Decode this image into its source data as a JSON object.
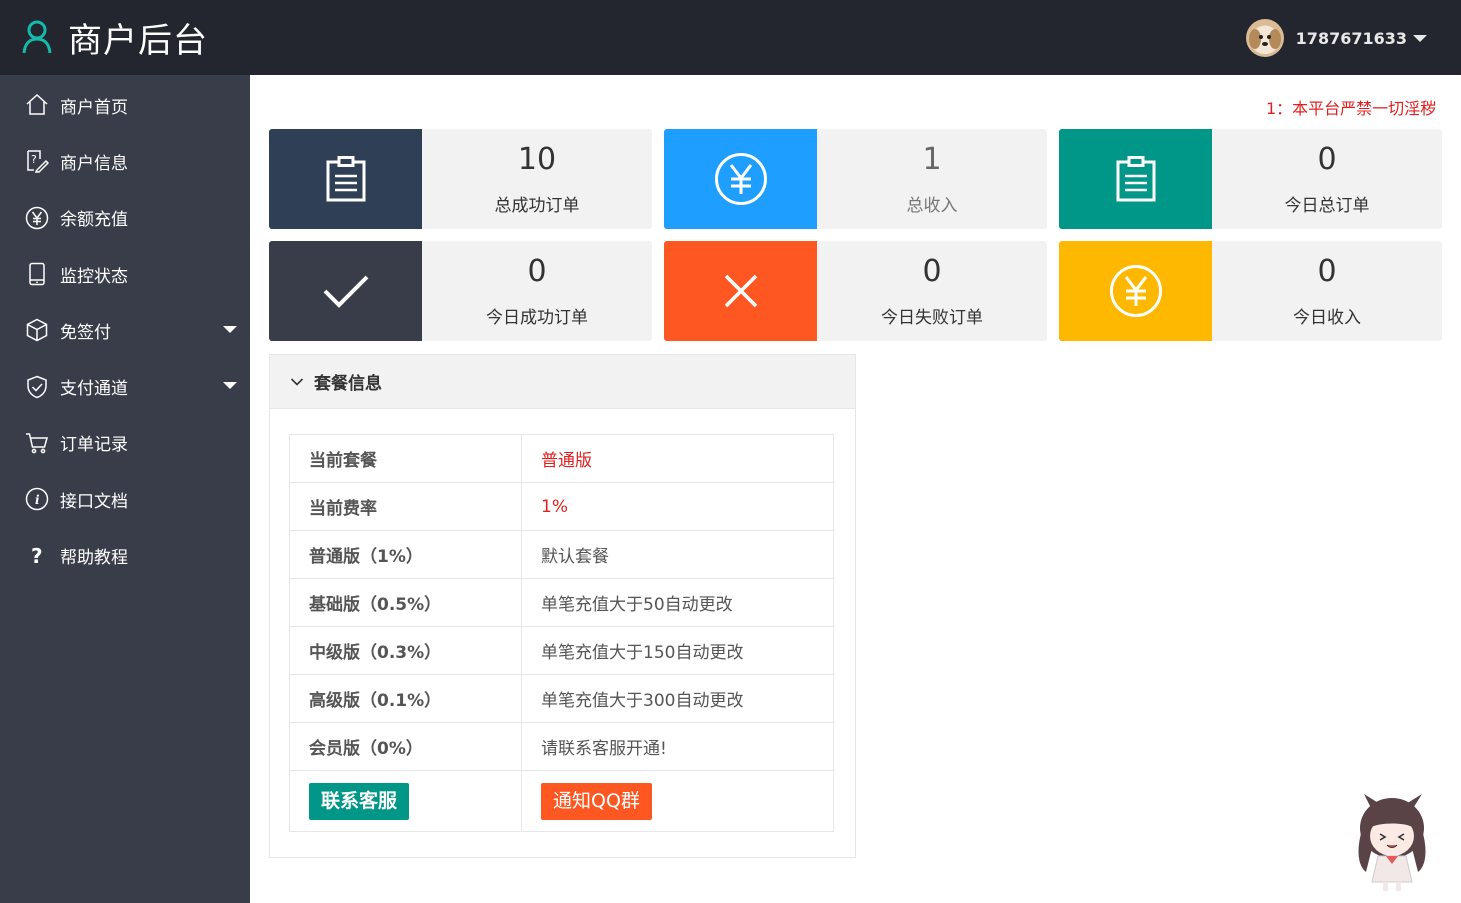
{
  "header": {
    "title": "商户后台",
    "user_name": "1787671633"
  },
  "sidebar": {
    "items": [
      {
        "label": "商户首页",
        "icon": "home-icon",
        "has_submenu": false
      },
      {
        "label": "商户信息",
        "icon": "edit-icon",
        "has_submenu": false
      },
      {
        "label": "余额充值",
        "icon": "yen-icon",
        "has_submenu": false
      },
      {
        "label": "监控状态",
        "icon": "cellphone-icon",
        "has_submenu": false
      },
      {
        "label": "免签付",
        "icon": "cube-icon",
        "has_submenu": true
      },
      {
        "label": "支付通道",
        "icon": "shield-icon",
        "has_submenu": true
      },
      {
        "label": "订单记录",
        "icon": "cart-icon",
        "has_submenu": false
      },
      {
        "label": "接口文档",
        "icon": "info-icon",
        "has_submenu": false
      },
      {
        "label": "帮助教程",
        "icon": "help-icon",
        "has_submenu": false
      }
    ]
  },
  "notice": "1：本平台严禁一切淫秽",
  "stats": [
    {
      "value": "10",
      "label": "总成功订单",
      "icon": "clipboard-icon",
      "color": "#2f4056"
    },
    {
      "value": "1",
      "label": "总收入",
      "icon": "yen-circle-icon",
      "color": "#1e9fff"
    },
    {
      "value": "0",
      "label": "今日总订单",
      "icon": "clipboard-icon",
      "color": "#009688"
    },
    {
      "value": "0",
      "label": "今日成功订单",
      "icon": "check-icon",
      "color": "#393d49"
    },
    {
      "value": "0",
      "label": "今日失败订单",
      "icon": "close-icon",
      "color": "#ff5722"
    },
    {
      "value": "0",
      "label": "今日收入",
      "icon": "yen-circle-icon",
      "color": "#ffb800"
    }
  ],
  "package_panel": {
    "title": "套餐信息",
    "rows": [
      {
        "key": "当前套餐",
        "value": "普通版"
      },
      {
        "key": "当前费率",
        "value": "1%"
      },
      {
        "key": "普通版（1%）",
        "value": "默认套餐"
      },
      {
        "key": "基础版（0.5%）",
        "value": "单笔充值大于50自动更改"
      },
      {
        "key": "中级版（0.3%）",
        "value": "单笔充值大于150自动更改"
      },
      {
        "key": "高级版（0.1%）",
        "value": "单笔充值大于300自动更改"
      },
      {
        "key": "会员版（0%）",
        "value": "请联系客服开通!"
      }
    ],
    "contact_button": "联系客服",
    "qq_button": "通知QQ群"
  }
}
